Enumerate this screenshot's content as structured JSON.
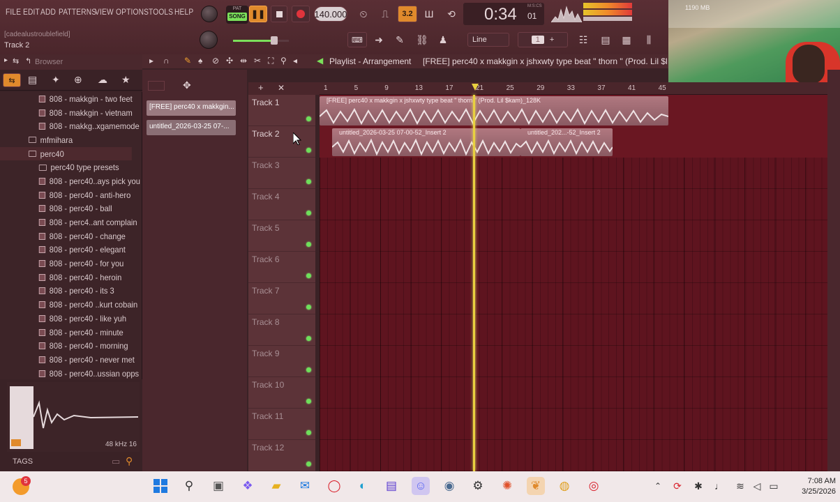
{
  "menu": [
    "FILE",
    "EDIT",
    "ADD",
    "PATTERNS",
    "VIEW",
    "OPTIONS",
    "TOOLS",
    "HELP"
  ],
  "hint": {
    "line1": "[cadealustroublefield]",
    "line2": "Track 2"
  },
  "transport": {
    "pat_label": "PAT",
    "song_label": "SONG",
    "tempo": "140.000",
    "time": "0:34",
    "time_sub": "01",
    "time_unit": "M:S:CS",
    "step_label": "3.2",
    "snap": "Line",
    "pattern_num": "1",
    "memory": "1190 MB"
  },
  "browser": {
    "title": "Browser",
    "items": [
      {
        "type": "file",
        "label": "808 - makkgin - two feet",
        "indent": 60
      },
      {
        "type": "file",
        "label": "808 - makkgin - vietnam",
        "indent": 60
      },
      {
        "type": "file",
        "label": "808 - makkg..xgamemode",
        "indent": 60
      },
      {
        "type": "folder",
        "label": "mfmihara",
        "indent": 44
      },
      {
        "type": "folder",
        "label": "perc40",
        "indent": 44
      },
      {
        "type": "folder",
        "label": "perc40 type presets",
        "indent": 60
      },
      {
        "type": "file",
        "label": "808 - perc40..ays pick you",
        "indent": 60
      },
      {
        "type": "file",
        "label": "808 - perc40 - anti-hero",
        "indent": 60
      },
      {
        "type": "file",
        "label": "808 - perc40 - ball",
        "indent": 60
      },
      {
        "type": "file",
        "label": "808 - perc4..ant complain",
        "indent": 60
      },
      {
        "type": "file",
        "label": "808 - perc40 - change",
        "indent": 60
      },
      {
        "type": "file",
        "label": "808 - perc40 - elegant",
        "indent": 60
      },
      {
        "type": "file",
        "label": "808 - perc40 - for you",
        "indent": 60
      },
      {
        "type": "file",
        "label": "808 - perc40 - heroin",
        "indent": 60
      },
      {
        "type": "file",
        "label": "808 - perc40 - its 3",
        "indent": 60
      },
      {
        "type": "file",
        "label": "808 - perc40 ..kurt cobain",
        "indent": 60
      },
      {
        "type": "file",
        "label": "808 - perc40 - like yuh",
        "indent": 60
      },
      {
        "type": "file",
        "label": "808 - perc40 - minute",
        "indent": 60
      },
      {
        "type": "file",
        "label": "808 - perc40 - morning",
        "indent": 60
      },
      {
        "type": "file",
        "label": "808 - perc40 - never met",
        "indent": 60
      },
      {
        "type": "file",
        "label": "808 - perc40..ussian opps",
        "indent": 60
      }
    ],
    "sample_info": "48 kHz 16",
    "tags_label": "TAGS"
  },
  "channels": [
    "[FREE] perc40 x makkgin...",
    "untitled_2026-03-25 07-..."
  ],
  "playlist": {
    "title": "Playlist - Arrangement",
    "pattern_title": "[FREE] perc40 x makkgin x jshxwty type beat \" thorn \" (Prod. Lil $kam)_128K",
    "ruler": [
      "1",
      "5",
      "9",
      "13",
      "17",
      "21",
      "25",
      "29",
      "33",
      "37",
      "41",
      "45"
    ],
    "tracks": [
      "Track 1",
      "Track 2",
      "Track 3",
      "Track 4",
      "Track 5",
      "Track 6",
      "Track 7",
      "Track 8",
      "Track 9",
      "Track 10",
      "Track 11",
      "Track 12"
    ],
    "clips": [
      {
        "label": "[FREE] perc40 x makkgin x jshxwty type beat \" thorn \" (Prod. Lil $kam)_128K"
      },
      {
        "label": "untitled_2026-03-25 07-00-52_Insert 2"
      },
      {
        "label": "untitled_202...-52_Insert 2"
      }
    ]
  },
  "taskbar": {
    "time": "7:08 AM",
    "date": "3/25/2026",
    "badge": "5"
  },
  "colors": {
    "bg": "#3a2226",
    "grid": "#5e141f",
    "accent": "#f39b2b",
    "clip": "#c98b95",
    "playhead": "#e8d040"
  }
}
